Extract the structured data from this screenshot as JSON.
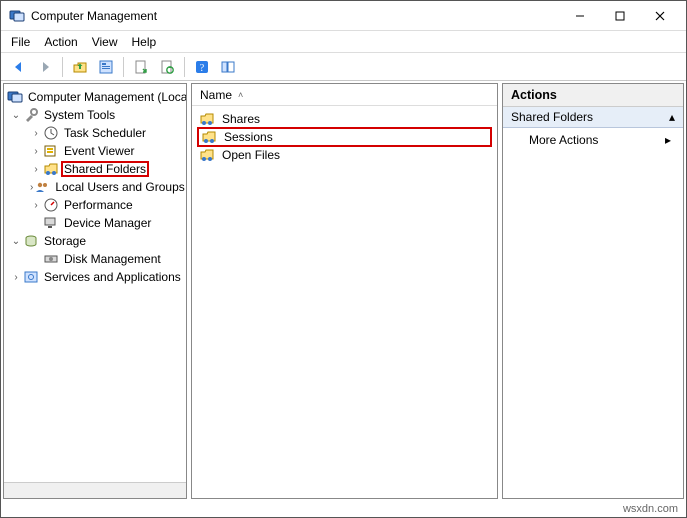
{
  "window": {
    "title": "Computer Management"
  },
  "menubar": {
    "file": "File",
    "action": "Action",
    "view": "View",
    "help": "Help"
  },
  "toolbar": {
    "back": "Back",
    "forward": "Forward",
    "up": "Up one level",
    "properties": "Properties",
    "export": "Export List",
    "refresh": "Refresh",
    "help": "Help",
    "show_hide": "Show/Hide"
  },
  "tree": {
    "root": "Computer Management (Local)",
    "system_tools": {
      "label": "System Tools",
      "task_scheduler": "Task Scheduler",
      "event_viewer": "Event Viewer",
      "shared_folders": "Shared Folders",
      "local_users": "Local Users and Groups",
      "performance": "Performance",
      "device_manager": "Device Manager"
    },
    "storage": {
      "label": "Storage",
      "disk_mgmt": "Disk Management"
    },
    "services": "Services and Applications"
  },
  "list": {
    "header_name": "Name",
    "items": {
      "shares": "Shares",
      "sessions": "Sessions",
      "open_files": "Open Files"
    }
  },
  "actions": {
    "header": "Actions",
    "group": "Shared Folders",
    "more": "More Actions"
  },
  "watermark": "wsxdn.com"
}
